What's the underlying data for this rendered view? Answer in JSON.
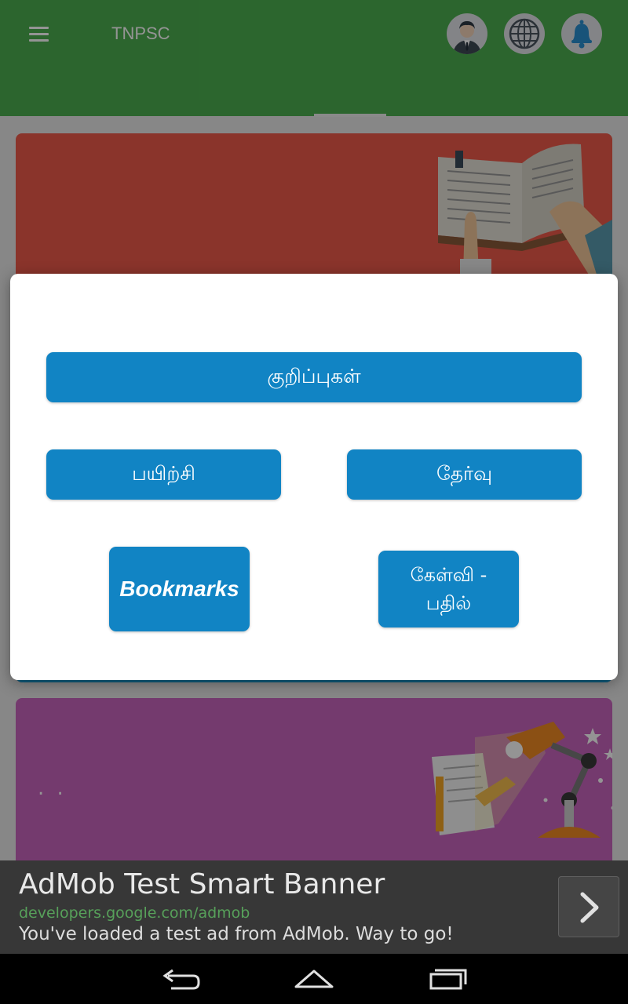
{
  "app_bar": {
    "title": "TNPSC",
    "color": "#4caf50",
    "icons": [
      "menu-icon",
      "user-profile-icon",
      "globe-icon",
      "notification-bell-icon"
    ]
  },
  "cards": {
    "notes_card_color": "#ee5a4a",
    "study_card_color": "#c964be",
    "study_card_text": ". ."
  },
  "dialog": {
    "notes_label": "குறிப்புகள்",
    "practice_label": "பயிற்சி",
    "exam_label": "தேர்வு",
    "bookmarks_label": "Bookmarks",
    "qa_label": "கேள்வி  - பதில்",
    "button_color": "#1184c4"
  },
  "ad": {
    "title": "AdMob Test Smart Banner",
    "url": "developers.google.com/admob",
    "text": "You've loaded a test ad from AdMob. Way to go!",
    "arrow_icon": "chevron-right-icon"
  },
  "nav_bar": {
    "icons": [
      "back-icon",
      "home-icon",
      "recent-apps-icon"
    ]
  }
}
